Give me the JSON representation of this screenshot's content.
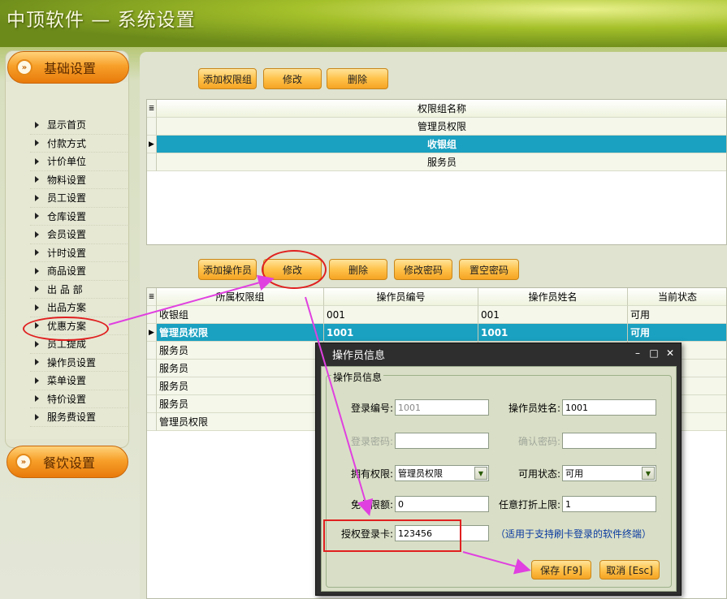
{
  "app": {
    "title": "中顶软件 — 系统设置"
  },
  "sidebar": {
    "section1": "基础设置",
    "section2": "餐饮设置",
    "items": [
      "显示首页",
      "付款方式",
      "计价单位",
      "物料设置",
      "员工设置",
      "仓库设置",
      "会员设置",
      "计时设置",
      "商品设置",
      "出 品 部",
      "出品方案",
      "优惠方案",
      "员工提成",
      "操作员设置",
      "菜单设置",
      "特价设置",
      "服务费设置"
    ]
  },
  "groups": {
    "buttons": {
      "add": "添加权限组",
      "edit": "修改",
      "delete": "删除"
    },
    "header": "权限组名称",
    "rows": [
      "管理员权限",
      "收银组",
      "服务员"
    ],
    "selected_row": 1
  },
  "operators": {
    "buttons": {
      "add": "添加操作员",
      "edit": "修改",
      "delete": "删除",
      "change_pwd": "修改密码",
      "clear_pwd": "置空密码"
    },
    "headers": [
      "所属权限组",
      "操作员编号",
      "操作员姓名",
      "当前状态"
    ],
    "rows": [
      [
        "收银组",
        "001",
        "001",
        "可用"
      ],
      [
        "管理员权限",
        "1001",
        "1001",
        "可用"
      ],
      [
        "服务员",
        "",
        "",
        ""
      ],
      [
        "服务员",
        "",
        "",
        ""
      ],
      [
        "服务员",
        "",
        "",
        ""
      ],
      [
        "服务员",
        "",
        "",
        ""
      ],
      [
        "管理员权限",
        "",
        "",
        ""
      ]
    ],
    "selected_row": 1
  },
  "dialog": {
    "title": "操作员信息",
    "legend": "操作员信息",
    "login_no_label": "登录编号:",
    "login_no_value": "1001",
    "name_label": "操作员姓名:",
    "name_value": "1001",
    "pwd_label": "登录密码:",
    "pwd_value": "",
    "confirm_label": "确认密码:",
    "confirm_value": "",
    "perm_label": "拥有权限:",
    "perm_value": "管理员权限",
    "status_label": "可用状态:",
    "status_value": "可用",
    "free_label": "免单限额:",
    "free_value": "0",
    "discount_label": "任意打折上限:",
    "discount_value": "1",
    "card_label": "授权登录卡:",
    "card_value": "123456",
    "card_hint": "（适用于支持刷卡登录的软件终端）",
    "save_label": "保存 [F9]",
    "cancel_label": "取消 [Esc]"
  },
  "colors": {
    "accent": "#f5a323",
    "selected": "#1aa0c0",
    "annotation": "#e02020",
    "arrow": "#e040e0"
  }
}
